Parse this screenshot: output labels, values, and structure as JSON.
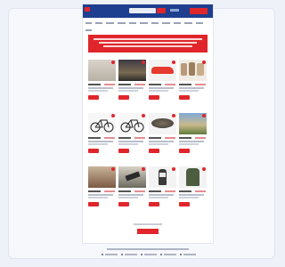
{
  "site": {
    "brand_color": "#1e3f8f",
    "accent_color": "#e0262b"
  },
  "products": [
    {
      "price": "",
      "kind": "room"
    },
    {
      "price": "",
      "kind": "landscape"
    },
    {
      "price": "",
      "kind": "shoes"
    },
    {
      "price": "",
      "kind": "jars"
    },
    {
      "price": "",
      "kind": "bicycle"
    },
    {
      "price": "",
      "kind": "bicycle"
    },
    {
      "price": "",
      "kind": "bowl"
    },
    {
      "price": "",
      "kind": "building"
    },
    {
      "price": "",
      "kind": "person"
    },
    {
      "price": "",
      "kind": "gadget"
    },
    {
      "price": "",
      "kind": "figure"
    },
    {
      "price": "",
      "kind": "jacket"
    }
  ]
}
